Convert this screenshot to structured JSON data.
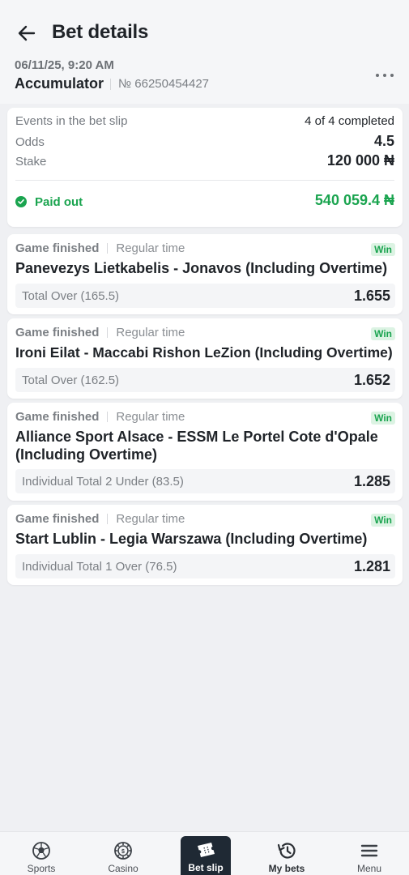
{
  "header": {
    "title": "Bet details",
    "date": "06/11/25, 9:20 AM",
    "bet_type": "Accumulator",
    "bet_number": "№ 66250454427"
  },
  "summary": {
    "events_label": "Events in the bet slip",
    "events_value": "4 of 4 completed",
    "odds_label": "Odds",
    "odds_value": "4.5",
    "stake_label": "Stake",
    "stake_value": "120 000 ₦",
    "status_label": "Paid out",
    "payout_value": "540 059.4 ₦"
  },
  "events": [
    {
      "status": "Game finished",
      "period": "Regular time",
      "badge": "Win",
      "title": "Panevezys Lietkabelis - Jonavos (Including Overtime)",
      "market": "Total Over (165.5)",
      "odds": "1.655"
    },
    {
      "status": "Game finished",
      "period": "Regular time",
      "badge": "Win",
      "title": "Ironi Eilat - Maccabi Rishon LeZion (Including Overtime)",
      "market": "Total Over (162.5)",
      "odds": "1.652"
    },
    {
      "status": "Game finished",
      "period": "Regular time",
      "badge": "Win",
      "title": "Alliance Sport Alsace - ESSM Le Portel Cote d'Opale (Including Overtime)",
      "market": "Individual Total 2 Under (83.5)",
      "odds": "1.285"
    },
    {
      "status": "Game finished",
      "period": "Regular time",
      "badge": "Win",
      "title": "Start Lublin - Legia Warszawa (Including Overtime)",
      "market": "Individual Total 1 Over (76.5)",
      "odds": "1.281"
    }
  ],
  "nav": {
    "sports": "Sports",
    "casino": "Casino",
    "bet_slip": "Bet slip",
    "my_bets": "My bets",
    "menu": "Menu"
  },
  "colors": {
    "accent_green": "#1aa44f",
    "win_badge_bg": "#dcf3e3",
    "nav_active_bg": "#1f2934",
    "page_bg": "#eff0f3"
  },
  "icons": {
    "back": "arrow-left-icon",
    "more": "more-dots-icon",
    "paid": "check-circle-icon",
    "sports": "soccer-ball-icon",
    "casino": "casino-chip-icon",
    "bet_slip": "ticket-icon",
    "my_bets": "history-icon",
    "menu": "hamburger-icon"
  }
}
